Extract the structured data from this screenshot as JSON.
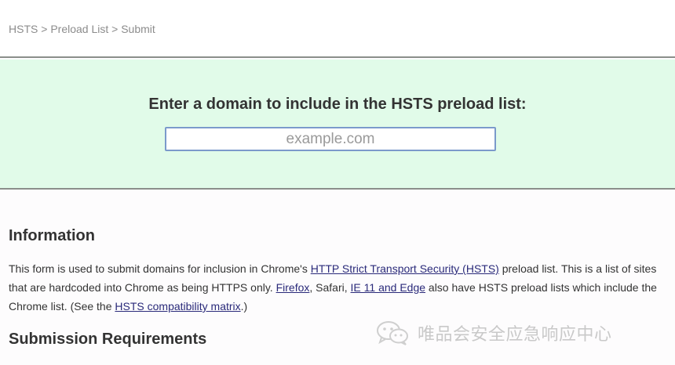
{
  "breadcrumb": {
    "item1": "HSTS",
    "sep1": " > ",
    "item2": "Preload List",
    "sep2": " > ",
    "item3": "Submit"
  },
  "hero": {
    "heading": "Enter a domain to include in the HSTS preload list:",
    "input_placeholder": "example.com",
    "input_value": ""
  },
  "information": {
    "title": "Information",
    "t1": "This form is used to submit domains for inclusion in Chrome's ",
    "link_hsts": "HTTP Strict Transport Security (HSTS)",
    "t2": " preload list. This is a list of sites that are hardcoded into Chrome as being HTTPS only. ",
    "link_firefox": "Firefox",
    "t3": ", Safari, ",
    "link_ie": "IE 11 and Edge",
    "t4": " also have HSTS preload lists which include the Chrome list. (See the ",
    "link_matrix": "HSTS compatibility matrix",
    "t5": ".)"
  },
  "requirements": {
    "title": "Submission Requirements"
  },
  "watermark": {
    "icon": "wechat-icon",
    "text": "唯品会安全应急响应中心"
  }
}
